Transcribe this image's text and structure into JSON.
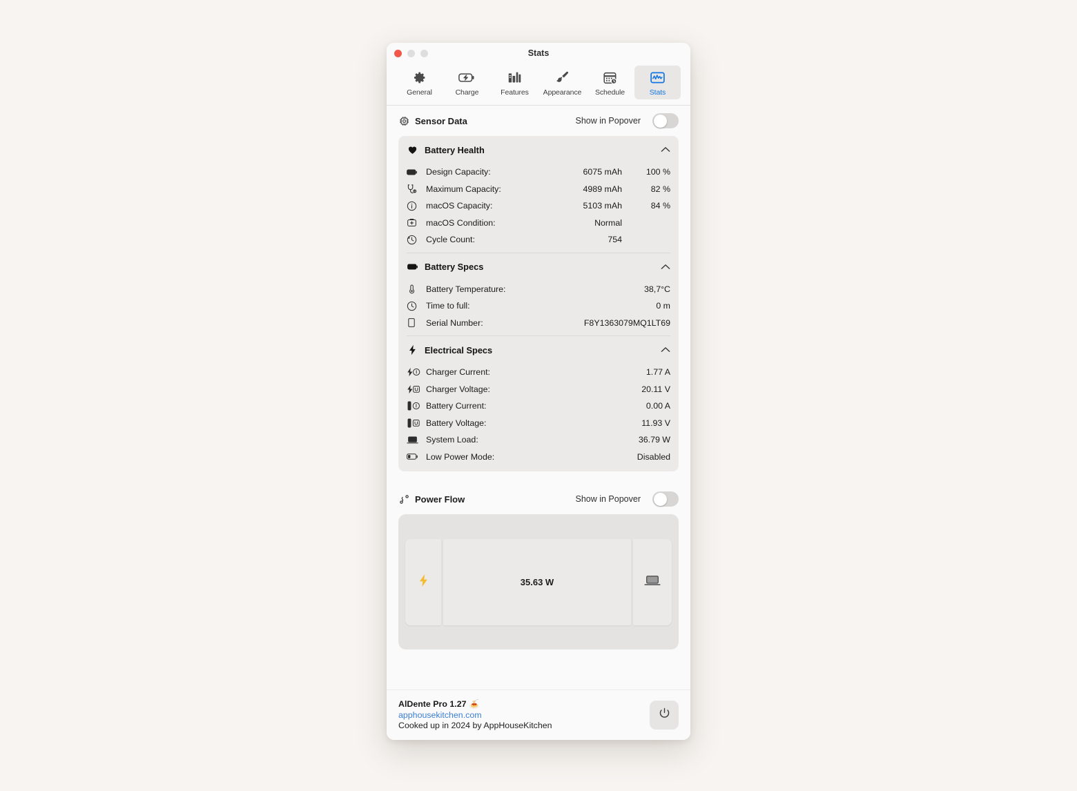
{
  "window": {
    "title": "Stats",
    "traffic_lights": [
      "close",
      "minimize",
      "maximize"
    ]
  },
  "toolbar": {
    "items": [
      {
        "label": "General",
        "icon": "gear-icon",
        "active": false
      },
      {
        "label": "Charge",
        "icon": "battery-bolt-icon",
        "active": false
      },
      {
        "label": "Features",
        "icon": "books-icon",
        "active": false
      },
      {
        "label": "Appearance",
        "icon": "paintbrush-icon",
        "active": false
      },
      {
        "label": "Schedule",
        "icon": "calendar-clock-icon",
        "active": false
      },
      {
        "label": "Stats",
        "icon": "waveform-chart-icon",
        "active": true
      }
    ],
    "accent_color": "#1275e4"
  },
  "sensor_data": {
    "title": "Sensor Data",
    "icon": "cpu-chip-icon",
    "popover_label": "Show in Popover",
    "toggle_state": "off",
    "groups": [
      {
        "title": "Battery Health",
        "icon": "heart-icon",
        "collapse_icon": "chevron-up-icon",
        "rows": [
          {
            "icon": "battery-full-icon",
            "label": "Design Capacity:",
            "value": "6075 mAh",
            "percent": "100 %"
          },
          {
            "icon": "health-pulse-icon",
            "label": "Maximum Capacity:",
            "value": "4989 mAh",
            "percent": "82 %"
          },
          {
            "icon": "info-circle-icon",
            "label": "macOS Capacity:",
            "value": "5103 mAh",
            "percent": "84 %"
          },
          {
            "icon": "medkit-icon",
            "label": "macOS Condition:",
            "value": "Normal",
            "percent": ""
          },
          {
            "icon": "clock-arrow-icon",
            "label": "Cycle Count:",
            "value": "754",
            "percent": ""
          }
        ]
      },
      {
        "title": "Battery Specs",
        "icon": "battery-icon",
        "collapse_icon": "chevron-up-icon",
        "rows": [
          {
            "icon": "thermometer-icon",
            "label": "Battery Temperature:",
            "value": "38,7°C",
            "percent": ""
          },
          {
            "icon": "clock-icon",
            "label": "Time to full:",
            "value": "0 m",
            "percent": ""
          },
          {
            "icon": "document-icon",
            "label": "Serial Number:",
            "value": "F8Y1363079MQ1LT69",
            "percent": ""
          }
        ]
      },
      {
        "title": "Electrical Specs",
        "icon": "bolt-icon",
        "collapse_icon": "chevron-up-icon",
        "rows": [
          {
            "icon": "bolt-current-icon",
            "label": "Charger Current:",
            "value": "1.77 A",
            "percent": ""
          },
          {
            "icon": "bolt-voltage-icon",
            "label": "Charger Voltage:",
            "value": "20.11 V",
            "percent": ""
          },
          {
            "icon": "battery-current-icon",
            "label": "Battery Current:",
            "value": "0.00 A",
            "percent": ""
          },
          {
            "icon": "battery-voltage-icon",
            "label": "Battery Voltage:",
            "value": "11.93 V",
            "percent": ""
          },
          {
            "icon": "laptop-icon",
            "label": "System Load:",
            "value": "36.79 W",
            "percent": ""
          },
          {
            "icon": "battery-low-icon",
            "label": "Low Power Mode:",
            "value": "Disabled",
            "percent": ""
          }
        ]
      }
    ]
  },
  "power_flow": {
    "title": "Power Flow",
    "icon": "cable-connector-icon",
    "popover_label": "Show in Popover",
    "toggle_state": "off",
    "source_icon": "bolt-yellow-icon",
    "watts": "35.63 W",
    "target_icon": "laptop-icon"
  },
  "footer": {
    "app_name": "AlDente Pro 1.27",
    "app_emoji": "🍝",
    "link": "apphousekitchen.com",
    "credit": "Cooked up in 2024 by AppHouseKitchen",
    "power_button_icon": "power-icon"
  }
}
